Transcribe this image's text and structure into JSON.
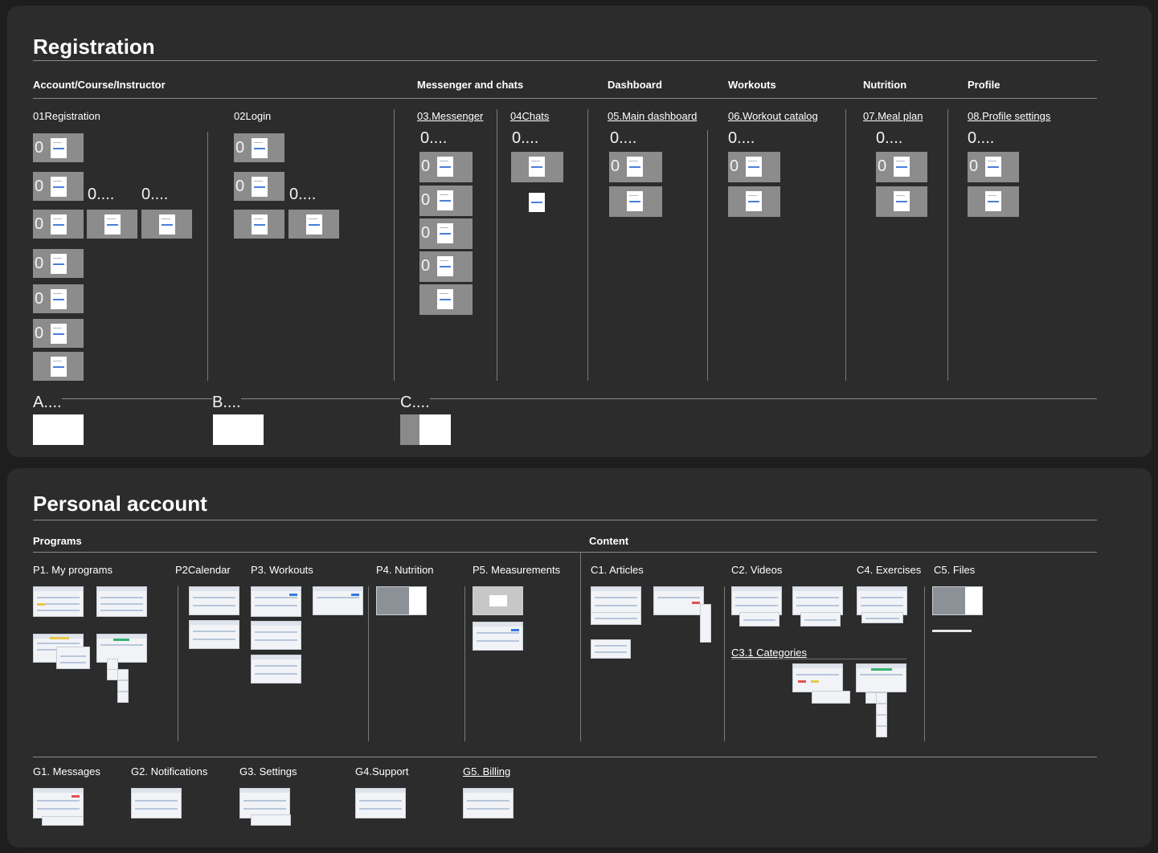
{
  "registration": {
    "title": "Registration",
    "categories": {
      "account": "Account/Course/Instructor",
      "messenger": "Messenger and chats",
      "dashboard": "Dashboard",
      "workouts": "Workouts",
      "nutrition": "Nutrition",
      "profile": "Profile"
    },
    "sections": {
      "s01": "01Registration",
      "s02": "02Login",
      "s03": "03.Messenger",
      "s04": "04Chats",
      "s05": "05.Main dashboard",
      "s06": "06.Workout catalog",
      "s07": "07.Meal plan",
      "s08": "08.Profile settings"
    },
    "truncated_label": "0....",
    "card_label": "0",
    "bottom": {
      "a": "A....",
      "b": "B....",
      "c": "C...."
    }
  },
  "personal_account": {
    "title": "Personal account",
    "categories": {
      "programs": "Programs",
      "content": "Content"
    },
    "sections": {
      "p1": "P1. My programs",
      "p2": "P2Calendar",
      "p3": "P3. Workouts",
      "p4": "P4. Nutrition",
      "p5": "P5. Measurements",
      "c1": "C1. Articles",
      "c2": "C2. Videos",
      "c31": "C3.1 Categories",
      "c4": "C4. Exercises",
      "c5": "C5. Files"
    },
    "general": {
      "g1": "G1. Messages",
      "g2": "G2. Notifications",
      "g3": "G3. Settings",
      "g4": "G4.Support",
      "g5": "G5. Billing"
    }
  },
  "colors": {
    "background": "#1e1e1e",
    "panel": "#2c2c2c",
    "card": "#8c8c8c",
    "accent": "#4a7fd8"
  }
}
